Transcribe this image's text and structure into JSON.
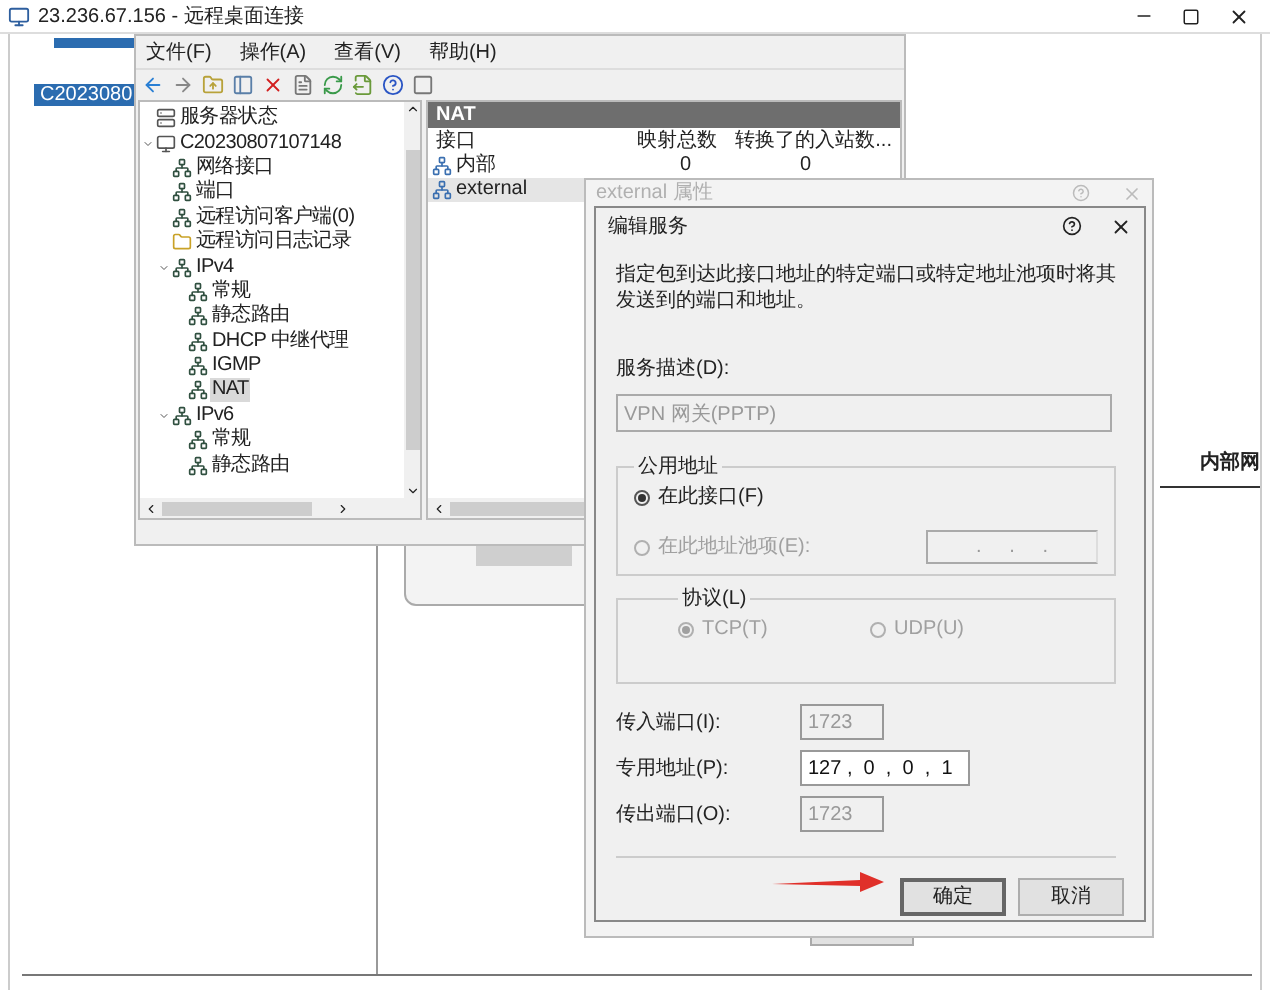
{
  "remote_desktop": {
    "title": "23.236.67.156 - 远程桌面连接"
  },
  "background_console": {
    "tree_item": {
      "label": "C2023080",
      "selected": true
    },
    "tab_label": "内部网"
  },
  "mmc": {
    "menu": [
      "文件(F)",
      "操作(A)",
      "查看(V)",
      "帮助(H)"
    ],
    "tree": [
      {
        "label": "服务器状态",
        "kind": "server",
        "selected": false
      },
      {
        "label": "C20230807107148",
        "kind": "computer",
        "selected": false,
        "expanded": true,
        "children": [
          {
            "label": "网络接口",
            "kind": "node",
            "selected": false
          },
          {
            "label": "端口",
            "kind": "node",
            "selected": false
          },
          {
            "label": "远程访问客户端(0)",
            "kind": "node",
            "selected": false
          },
          {
            "label": "远程访问日志记录",
            "kind": "folder",
            "selected": false
          },
          {
            "label": "IPv4",
            "kind": "node",
            "selected": false,
            "expanded": true,
            "children": [
              {
                "label": "常规",
                "kind": "node",
                "selected": false
              },
              {
                "label": "静态路由",
                "kind": "node",
                "selected": false
              },
              {
                "label": "DHCP 中继代理",
                "kind": "node",
                "selected": false
              },
              {
                "label": "IGMP",
                "kind": "node",
                "selected": false
              },
              {
                "label": "NAT",
                "kind": "node",
                "selected": true
              }
            ]
          },
          {
            "label": "IPv6",
            "kind": "node",
            "selected": false,
            "expanded": true,
            "children": [
              {
                "label": "常规",
                "kind": "node",
                "selected": false
              },
              {
                "label": "静态路由",
                "kind": "node",
                "selected": false
              }
            ]
          }
        ]
      }
    ],
    "list": {
      "title": "NAT",
      "columns": [
        "接口",
        "映射总数",
        "转换了的入站数..."
      ],
      "rows": [
        {
          "cells": [
            "内部",
            "0",
            "0"
          ],
          "selected": false
        },
        {
          "cells": [
            "external"
          ],
          "selected": true
        }
      ]
    }
  },
  "properties_dialog": {
    "title": "external 属性"
  },
  "edit_service": {
    "title": "编辑服务",
    "description": "指定包到达此接口地址的特定端口或特定地址池项时将其发送到的端口和地址。",
    "service_label": "服务描述(D):",
    "service_value": "VPN 网关(PPTP)",
    "public_address": {
      "title": "公用地址",
      "options": [
        {
          "label": "在此接口(F)",
          "selected": true,
          "disabled": false
        },
        {
          "label": "在此地址池项(E):",
          "selected": false,
          "disabled": true
        }
      ],
      "pool_address": ".     .     ."
    },
    "protocol": {
      "title": "协议(L)",
      "options": [
        {
          "label": "TCP(T)",
          "selected": true,
          "disabled": true
        },
        {
          "label": "UDP(U)",
          "selected": false,
          "disabled": true
        }
      ]
    },
    "fields": [
      {
        "label": "传入端口(I):",
        "value": "1723",
        "disabled": true
      },
      {
        "label": "专用地址(P):",
        "value": "127 ,  0  ,  0  ,  1",
        "disabled": false
      },
      {
        "label": "传出端口(O):",
        "value": "1723",
        "disabled": true
      }
    ],
    "buttons": [
      {
        "label": "确定",
        "default": true
      },
      {
        "label": "取消",
        "default": false
      }
    ]
  }
}
